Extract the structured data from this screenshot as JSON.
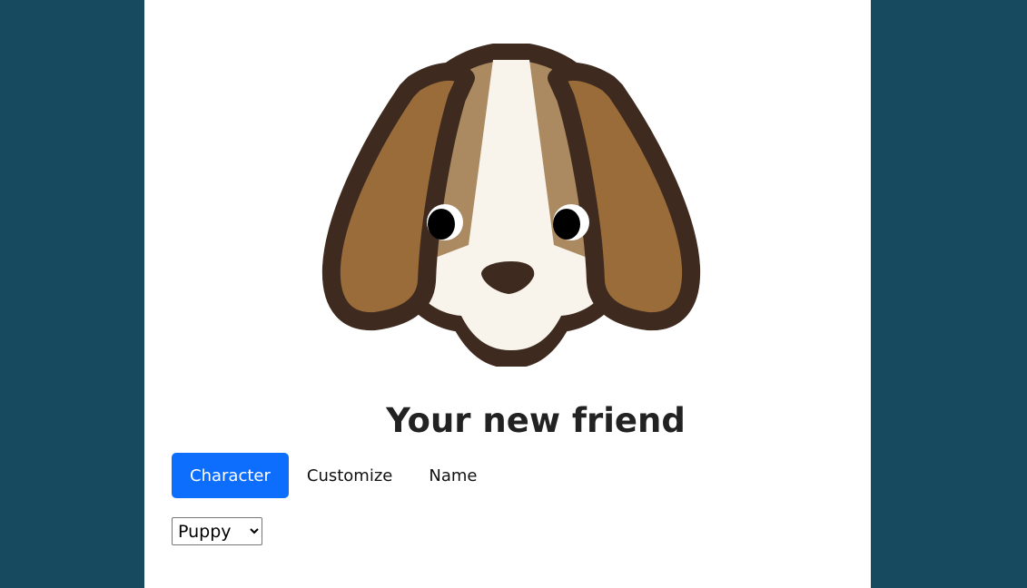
{
  "page": {
    "title": "Your new friend"
  },
  "illustration": {
    "icon": "dog-face-icon"
  },
  "tabs": [
    {
      "label": "Character",
      "active": true
    },
    {
      "label": "Customize",
      "active": false
    },
    {
      "label": "Name",
      "active": false
    }
  ],
  "character_select": {
    "selected": "Puppy",
    "options": [
      "Puppy"
    ]
  },
  "colors": {
    "background": "#174a5e",
    "panel": "#ffffff",
    "active_tab": "#0d6efd",
    "dog_outline": "#3e2a1e",
    "dog_ear": "#9a6c3a",
    "dog_fur": "#ab8a62",
    "dog_muzzle": "#f8f4ec"
  }
}
